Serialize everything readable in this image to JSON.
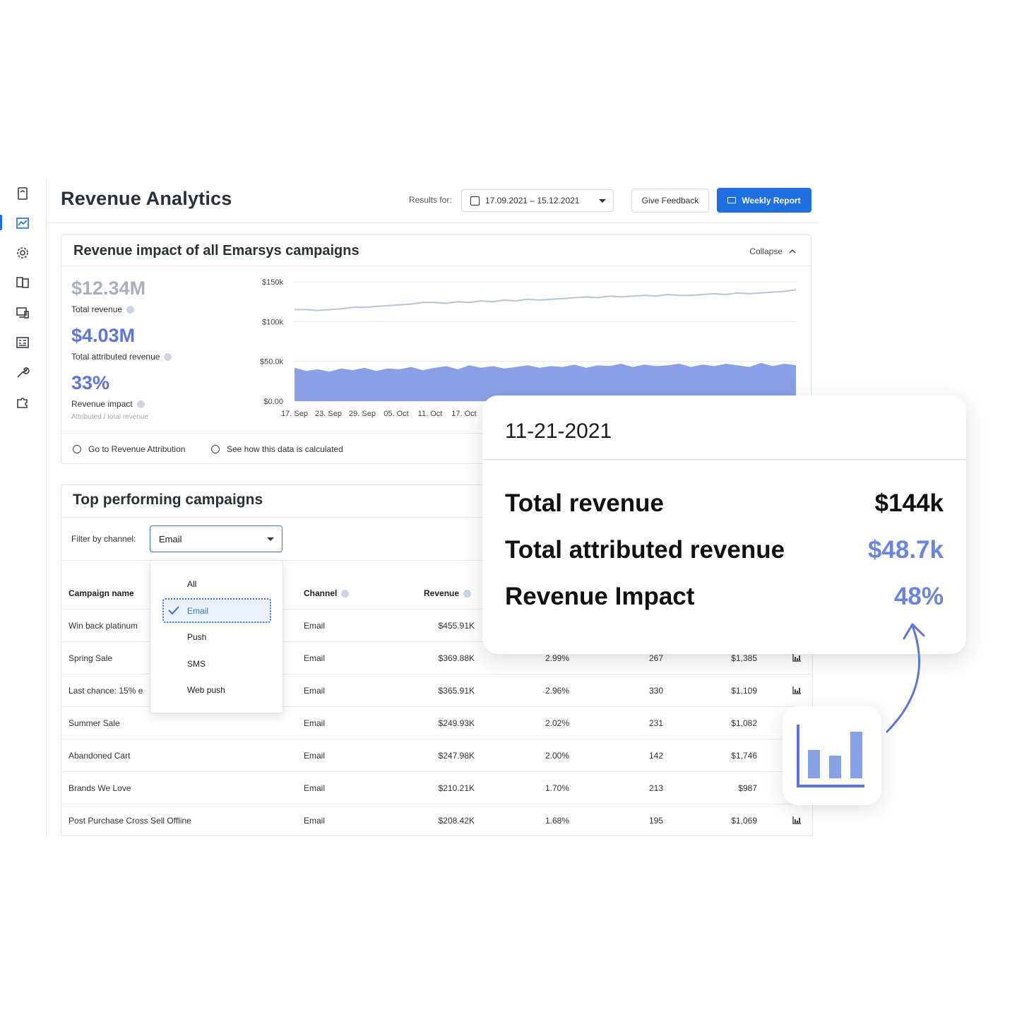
{
  "header": {
    "title": "Revenue Analytics",
    "results_label": "Results for:",
    "date_range": "17.09.2021 – 15.12.2021",
    "feedback_label": "Give Feedback",
    "weekly_label": "Weekly Report"
  },
  "sidebar": {
    "items": [
      {
        "icon": "bookmark-icon"
      },
      {
        "icon": "analytics-chart-icon",
        "active": true
      },
      {
        "icon": "settings-gear-icon"
      },
      {
        "icon": "content-library-icon"
      },
      {
        "icon": "devices-icon"
      },
      {
        "icon": "contacts-list-icon"
      },
      {
        "icon": "wrench-icon"
      },
      {
        "icon": "puzzle-icon"
      }
    ]
  },
  "revenue_card": {
    "title": "Revenue impact of all Emarsys campaigns",
    "collapse_label": "Collapse",
    "total_revenue": "$12.34M",
    "total_revenue_label": "Total revenue",
    "attributed": "$4.03M",
    "attributed_label": "Total attributed revenue",
    "impact": "33%",
    "impact_label": "Revenue impact",
    "impact_sub": "Attributed / total revenue",
    "link_attribution": "Go to Revenue Attribution",
    "link_calc": "See how this data is calculated"
  },
  "chart_data": {
    "type": "area",
    "y_ticks": [
      "$150k",
      "$100k",
      "$50.0k",
      "$0.00"
    ],
    "ylim": [
      0,
      150000
    ],
    "x_ticks": [
      "17. Sep",
      "23. Sep",
      "29. Sep",
      "05. Oct",
      "11. Oct",
      "17. Oct"
    ],
    "series": [
      {
        "kind": "line",
        "color": "#b7c6d6",
        "values": [
          115000,
          115000,
          114000,
          115000,
          116000,
          118000,
          118000,
          119000,
          120000,
          121000,
          122000,
          124000,
          124000,
          123000,
          125000,
          124000,
          126000,
          125000,
          127000,
          126000,
          128000,
          127000,
          128000,
          129000,
          130000,
          131000,
          130000,
          132000,
          131000,
          132000,
          133000,
          132000,
          134000,
          133000,
          133000,
          134000,
          135000,
          134000,
          136000,
          135000,
          136000,
          137000,
          138000,
          140000
        ]
      },
      {
        "kind": "area",
        "color": "#8aa0e6",
        "values": [
          42000,
          38000,
          40000,
          37000,
          41000,
          39000,
          42000,
          38000,
          41000,
          40000,
          43000,
          39000,
          42000,
          44000,
          40000,
          45000,
          42000,
          44000,
          41000,
          43000,
          45000,
          42000,
          44000,
          43000,
          46000,
          42000,
          45000,
          44000,
          47000,
          43000,
          46000,
          44000,
          45000,
          47000,
          43000,
          46000,
          44000,
          47000,
          45000,
          43000,
          48000,
          44000,
          47000,
          45000
        ]
      }
    ]
  },
  "top_campaigns": {
    "title": "Top performing campaigns",
    "filter_label": "Filter by channel:",
    "filter_value": "Email",
    "columns": {
      "name": "Campaign name",
      "channel": "Channel",
      "revenue": "Revenue"
    },
    "dropdown_options": [
      "All",
      "Email",
      "Push",
      "SMS",
      "Web push"
    ],
    "rows": [
      {
        "name": "Win back platinum",
        "channel": "Email",
        "revenue": "$455.91K",
        "pct": "",
        "count": "",
        "avg": "",
        "icon": false
      },
      {
        "name": "Spring Sale",
        "channel": "Email",
        "revenue": "$369.88K",
        "pct": "2.99%",
        "count": "267",
        "avg": "$1,385",
        "icon": true
      },
      {
        "name": "Last chance: 15% e",
        "channel": "Email",
        "revenue": "$365.91K",
        "pct": "2.96%",
        "count": "330",
        "avg": "$1,109",
        "icon": true
      },
      {
        "name": "Summer Sale",
        "channel": "Email",
        "revenue": "$249.93K",
        "pct": "2.02%",
        "count": "231",
        "avg": "$1,082",
        "icon": false
      },
      {
        "name": "Abandoned Cart",
        "channel": "Email",
        "revenue": "$247.98K",
        "pct": "2.00%",
        "count": "142",
        "avg": "$1,746",
        "icon": false
      },
      {
        "name": "Brands We Love",
        "channel": "Email",
        "revenue": "$210.21K",
        "pct": "1.70%",
        "count": "213",
        "avg": "$987",
        "icon": false
      },
      {
        "name": "Post Purchase Cross Sell Offline",
        "channel": "Email",
        "revenue": "$208.42K",
        "pct": "1.68%",
        "count": "195",
        "avg": "$1,069",
        "icon": true
      }
    ]
  },
  "tooltip": {
    "date": "11-21-2021",
    "total_revenue_label": "Total revenue",
    "total_revenue": "$144k",
    "attributed_label": "Total attributed revenue",
    "attributed": "$48.7k",
    "impact_label": "Revenue Impact",
    "impact": "48%"
  },
  "colors": {
    "accent": "#1f6fe0",
    "kpi": "#5b74e0",
    "kpi_muted": "#a9afbd",
    "bar": "#8aa0e6"
  }
}
